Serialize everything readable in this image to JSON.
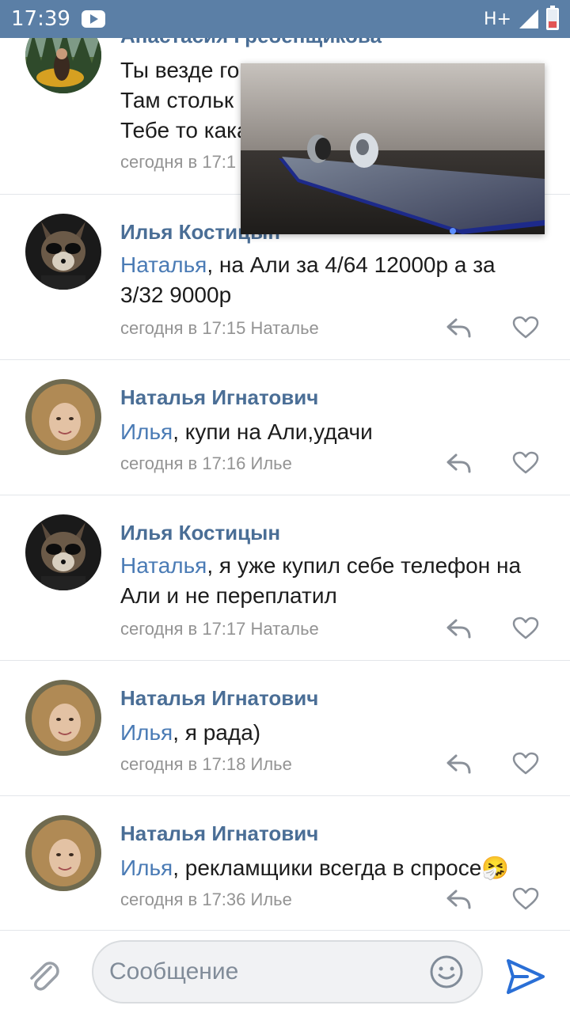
{
  "status_bar": {
    "time": "17:39",
    "network": "H+"
  },
  "comments": [
    {
      "author": "Анастасия Гребенщикова",
      "lines": [
        "Ты везде го",
        "Там стольк",
        "Тебе то кака"
      ],
      "date": "сегодня в 17:1"
    },
    {
      "author": "Илья Костицын",
      "mention": "Наталья",
      "text": ", на Али за 4/64 12000р а за 3/32 9000р",
      "date": "сегодня в 17:15",
      "reply_to": "Наталье"
    },
    {
      "author": "Наталья Игнатович",
      "mention": "Илья",
      "text": ", купи на Али,удачи",
      "date": "сегодня в 17:16",
      "reply_to": "Илье"
    },
    {
      "author": "Илья Костицын",
      "mention": "Наталья",
      "text": ", я уже купил себе телефон на Али  и не переплатил",
      "date": "сегодня в 17:17",
      "reply_to": "Наталье"
    },
    {
      "author": "Наталья Игнатович",
      "mention": "Илья",
      "text": ", я рада)",
      "date": "сегодня в 17:18",
      "reply_to": "Илье"
    },
    {
      "author": "Наталья Игнатович",
      "mention": "Илья",
      "text": ", рекламщики всегда в спросе",
      "emoji": "🤧",
      "date": "сегодня в 17:36",
      "reply_to": "Илье"
    }
  ],
  "composer": {
    "placeholder": "Сообщение"
  },
  "colors": {
    "header": "#5b7fa6",
    "author": "#4a6e96",
    "mention": "#4a7bb5",
    "meta": "#939393",
    "send": "#2a6fd6"
  }
}
